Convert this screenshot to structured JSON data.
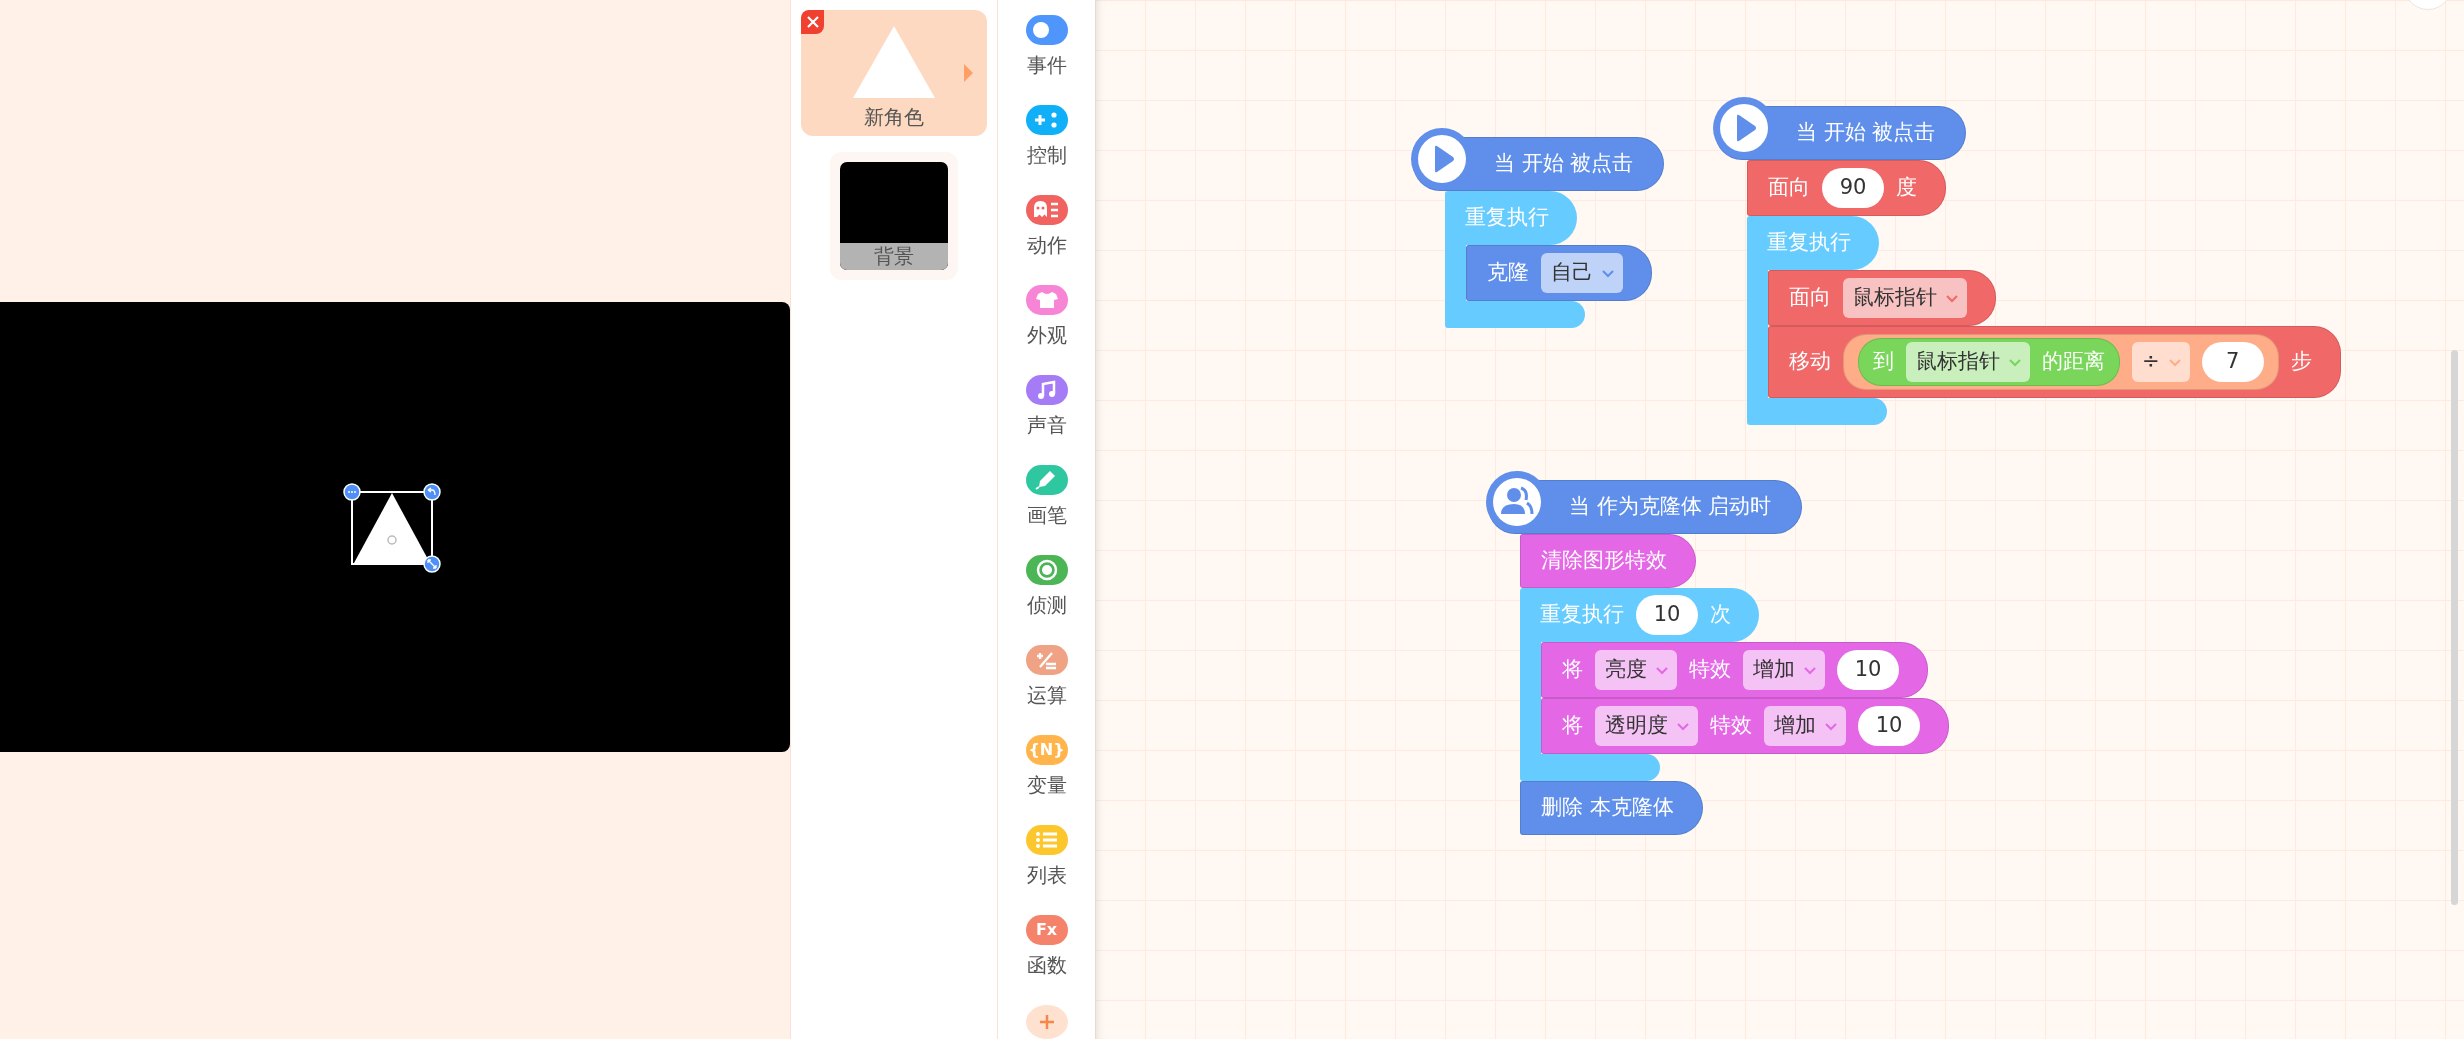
{
  "sprites": [
    {
      "name": "新角色",
      "kind": "sprite",
      "selected": true
    },
    {
      "name": "背景",
      "kind": "backdrop",
      "selected": false
    }
  ],
  "categories": [
    {
      "label": "事件",
      "kind": "toggle",
      "color": "#4f96fc"
    },
    {
      "label": "控制",
      "kind": "gamepad",
      "color": "#10b0f8"
    },
    {
      "label": "动作",
      "kind": "ghost",
      "color": "#f06360"
    },
    {
      "label": "外观",
      "kind": "shirt",
      "color": "#f884d6"
    },
    {
      "label": "声音",
      "kind": "note",
      "color": "#a57cf5"
    },
    {
      "label": "画笔",
      "kind": "pen",
      "color": "#2fc7a0"
    },
    {
      "label": "侦测",
      "kind": "target",
      "color": "#4cb556"
    },
    {
      "label": "运算",
      "kind": "math",
      "color": "#f0a284"
    },
    {
      "label": "变量",
      "kind": "text_icon",
      "icon_text": "{N}",
      "color": "#ffb54c"
    },
    {
      "label": "列表",
      "kind": "list",
      "color": "#fcc62d"
    },
    {
      "label": "函数",
      "kind": "text_icon",
      "icon_text": "Fx",
      "color": "#f5836b"
    },
    {
      "kind": "add",
      "color": "#ffe1cf"
    }
  ],
  "scripts": [
    {
      "blocks": [
        {
          "kind": "hat_flag",
          "color": "#5f8fea",
          "parts": [
            {
              "kind": "text",
              "text": "当 开始 被点击"
            }
          ]
        },
        {
          "kind": "loop",
          "color": "#66ccff",
          "parts": [
            {
              "kind": "text",
              "text": "重复执行"
            }
          ],
          "children": [
            {
              "kind": "command",
              "color": "#5f8fea",
              "parts": [
                {
                  "kind": "text",
                  "text": "克隆"
                },
                {
                  "kind": "dropdown",
                  "text": "自己"
                }
              ]
            }
          ]
        }
      ]
    },
    {
      "blocks": [
        {
          "kind": "hat_flag",
          "color": "#5f8fea",
          "parts": [
            {
              "kind": "text",
              "text": "当 开始 被点击"
            }
          ]
        },
        {
          "kind": "command",
          "color": "#f06868",
          "parts": [
            {
              "kind": "text",
              "text": "面向"
            },
            {
              "kind": "number",
              "text": "90"
            },
            {
              "kind": "text",
              "text": "度"
            }
          ]
        },
        {
          "kind": "loop",
          "color": "#66ccff",
          "parts": [
            {
              "kind": "text",
              "text": "重复执行"
            }
          ],
          "children": [
            {
              "kind": "command",
              "color": "#f06868",
              "parts": [
                {
                  "kind": "text",
                  "text": "面向"
                },
                {
                  "kind": "dropdown",
                  "text": "鼠标指针"
                }
              ]
            },
            {
              "kind": "command",
              "color": "#f06868",
              "parts": [
                {
                  "kind": "text",
                  "text": "移动"
                },
                {
                  "kind": "reporter",
                  "color": "#ffad88",
                  "parts": [
                    {
                      "kind": "reporter",
                      "color": "#79d65a",
                      "parts": [
                        {
                          "kind": "text",
                          "text": "到"
                        },
                        {
                          "kind": "dropdown",
                          "text": "鼠标指针"
                        },
                        {
                          "kind": "text",
                          "text": "的距离"
                        }
                      ]
                    },
                    {
                      "kind": "dropdown",
                      "text": "÷"
                    },
                    {
                      "kind": "number",
                      "text": "7"
                    }
                  ]
                },
                {
                  "kind": "text",
                  "text": "步"
                }
              ]
            }
          ]
        }
      ]
    },
    {
      "blocks": [
        {
          "kind": "hat_clone",
          "color": "#5f8fea",
          "parts": [
            {
              "kind": "text",
              "text": "当 作为克隆体 启动时"
            }
          ]
        },
        {
          "kind": "command",
          "color": "#e468e6",
          "parts": [
            {
              "kind": "text",
              "text": "清除图形特效"
            }
          ]
        },
        {
          "kind": "loop",
          "color": "#66ccff",
          "parts": [
            {
              "kind": "text",
              "text": "重复执行"
            },
            {
              "kind": "number",
              "text": "10"
            },
            {
              "kind": "text",
              "text": "次"
            }
          ],
          "children": [
            {
              "kind": "command",
              "color": "#e468e6",
              "parts": [
                {
                  "kind": "text",
                  "text": "将"
                },
                {
                  "kind": "dropdown",
                  "text": "亮度"
                },
                {
                  "kind": "text",
                  "text": "特效"
                },
                {
                  "kind": "dropdown",
                  "text": "增加"
                },
                {
                  "kind": "number",
                  "text": "10"
                }
              ]
            },
            {
              "kind": "command",
              "color": "#e468e6",
              "parts": [
                {
                  "kind": "text",
                  "text": "将"
                },
                {
                  "kind": "dropdown",
                  "text": "透明度"
                },
                {
                  "kind": "text",
                  "text": "特效"
                },
                {
                  "kind": "dropdown",
                  "text": "增加"
                },
                {
                  "kind": "number",
                  "text": "10"
                }
              ]
            }
          ]
        },
        {
          "kind": "command",
          "color": "#5f8fea",
          "parts": [
            {
              "kind": "text",
              "text": "删除 本克隆体"
            }
          ]
        }
      ]
    }
  ]
}
